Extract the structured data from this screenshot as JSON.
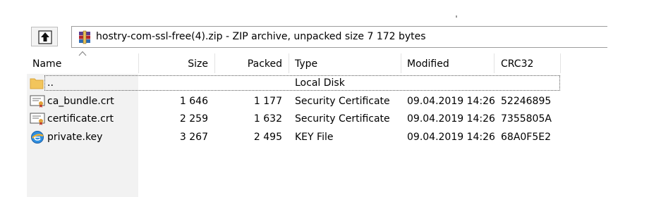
{
  "toolbar": {
    "up_button": "up-folder",
    "path": "hostry-com-ssl-free(4).zip - ZIP archive, unpacked size 7 172 bytes"
  },
  "columns": {
    "name": "Name",
    "size": "Size",
    "packed": "Packed",
    "type": "Type",
    "modified": "Modified",
    "crc32": "CRC32"
  },
  "rows": [
    {
      "name": "..",
      "size": "",
      "packed": "",
      "type": "Local Disk",
      "modified": "",
      "crc": "",
      "icon": "folder-icon"
    },
    {
      "name": "ca_bundle.crt",
      "size": "1 646",
      "packed": "1 177",
      "type": "Security Certificate",
      "modified": "09.04.2019 14:26",
      "crc": "52246895",
      "icon": "certificate-icon"
    },
    {
      "name": "certificate.crt",
      "size": "2 259",
      "packed": "1 632",
      "type": "Security Certificate",
      "modified": "09.04.2019 14:26",
      "crc": "7355805A",
      "icon": "certificate-icon"
    },
    {
      "name": "private.key",
      "size": "3 267",
      "packed": "2 495",
      "type": "KEY File",
      "modified": "09.04.2019 14:26",
      "crc": "68A0F5E2",
      "icon": "key-file-icon"
    }
  ],
  "colors": {
    "folder": "#f2c55c",
    "accent": "#1d7fd9",
    "archive_red": "#b3242b",
    "archive_purple": "#5b3a8e"
  }
}
